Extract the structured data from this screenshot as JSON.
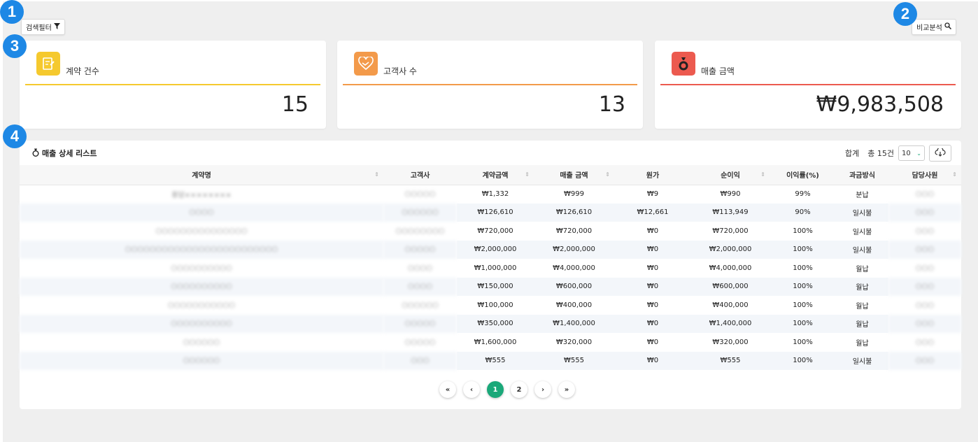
{
  "filter_button": {
    "label": "검색필터"
  },
  "compare_button": {
    "label": "비교분석"
  },
  "markers": [
    "1",
    "2",
    "3",
    "4"
  ],
  "cards": [
    {
      "label": "계약 건수",
      "value": "15",
      "icon": "contract-icon",
      "color": "#f5c92e"
    },
    {
      "label": "고객사 수",
      "value": "13",
      "icon": "handshake-icon",
      "color": "#f39a4a"
    },
    {
      "label": "매출 금액",
      "value": "₩9,983,508",
      "icon": "money-bag-icon",
      "color": "#ec5a4f"
    }
  ],
  "list": {
    "title": "매출 상세 리스트",
    "sum_label": "합계",
    "total_label": "총 15건",
    "page_size": "10",
    "columns": [
      "계약명",
      "고객사",
      "계약금액",
      "매출 금액",
      "원가",
      "순이익",
      "이익률(%)",
      "과금방식",
      "담당사원"
    ],
    "rows": [
      [
        "용담××××××××",
        "○○○○○",
        "₩1,332",
        "₩999",
        "₩9",
        "₩990",
        "99%",
        "분납",
        "○○○"
      ],
      [
        "○○○○",
        "○○○○○○",
        "₩126,610",
        "₩126,610",
        "₩12,661",
        "₩113,949",
        "90%",
        "일시불",
        "○○○"
      ],
      [
        "○○○○○○○○○○○○○○○",
        "○○○○○○○○",
        "₩720,000",
        "₩720,000",
        "₩0",
        "₩720,000",
        "100%",
        "일시불",
        "○○○"
      ],
      [
        "○○○○○○○○○○○○○○○○○○○○○○○○○",
        "○○○○○",
        "₩2,000,000",
        "₩2,000,000",
        "₩0",
        "₩2,000,000",
        "100%",
        "일시불",
        "○○○"
      ],
      [
        "○○○○○○○○○○",
        "○○○○",
        "₩1,000,000",
        "₩4,000,000",
        "₩0",
        "₩4,000,000",
        "100%",
        "월납",
        "○○○"
      ],
      [
        "○○○○○○○○○○",
        "○○○○",
        "₩150,000",
        "₩600,000",
        "₩0",
        "₩600,000",
        "100%",
        "월납",
        "○○○"
      ],
      [
        "○○○○○○○○○○○",
        "○○○○○○",
        "₩100,000",
        "₩400,000",
        "₩0",
        "₩400,000",
        "100%",
        "월납",
        "○○○"
      ],
      [
        "○○○○○○○○○○",
        "○○○○○",
        "₩350,000",
        "₩1,400,000",
        "₩0",
        "₩1,400,000",
        "100%",
        "월납",
        "○○○"
      ],
      [
        "○○○○○○",
        "○○○○○",
        "₩1,600,000",
        "₩320,000",
        "₩0",
        "₩320,000",
        "100%",
        "월납",
        "○○○"
      ],
      [
        "○○○○○○",
        "○○○",
        "₩555",
        "₩555",
        "₩0",
        "₩555",
        "100%",
        "일시불",
        "○○○"
      ]
    ]
  },
  "pagination": {
    "first": "«",
    "prev": "‹",
    "pages": [
      "1",
      "2"
    ],
    "next": "›",
    "last": "»"
  },
  "colors": {
    "accent_green": "#1aa879",
    "marker_blue": "#1e88e5"
  }
}
